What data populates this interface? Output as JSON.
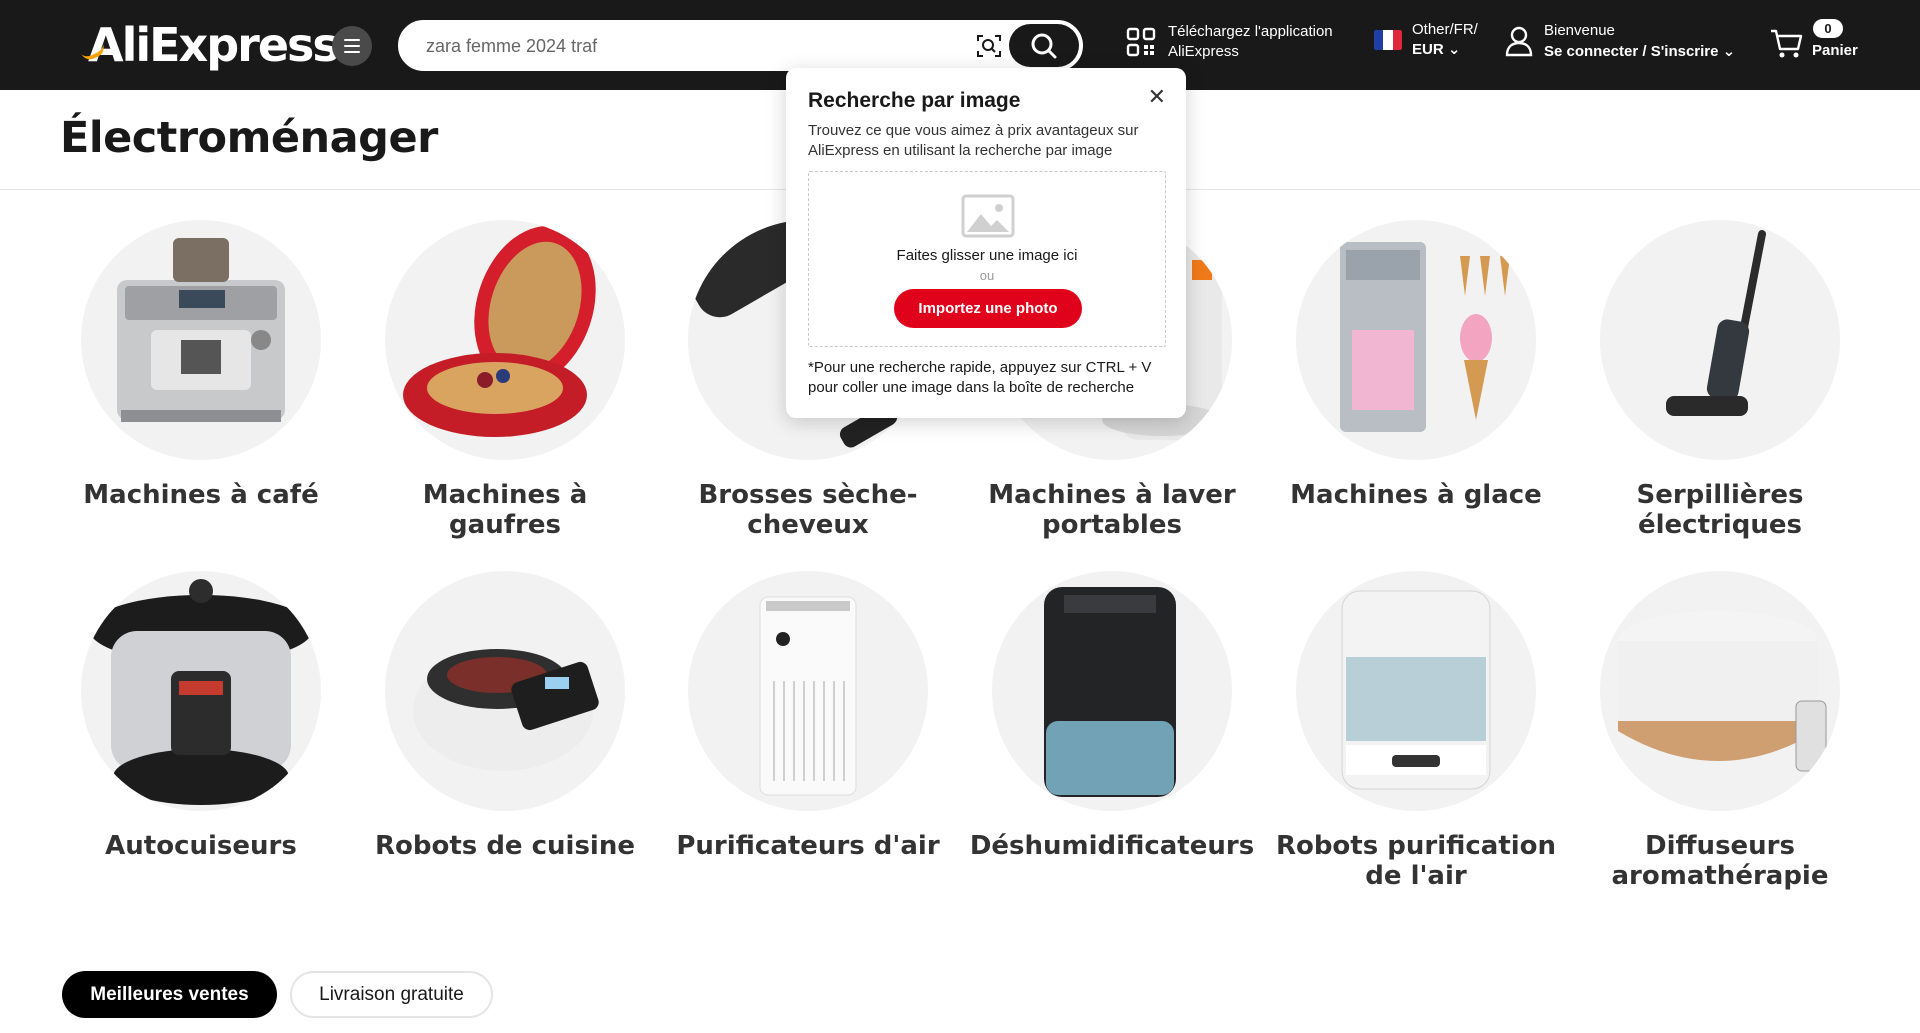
{
  "header": {
    "logo_text": "AliExpress",
    "search_value": "zara femme 2024 traf",
    "app_download_line1": "Téléchargez l'application",
    "app_download_line2": "AliExpress",
    "lang_line1": "Other/FR/",
    "lang_line2": "EUR",
    "account_line1": "Bienvenue",
    "account_line2": "Se connecter / S'inscrire",
    "cart_count": "0",
    "cart_label": "Panier"
  },
  "page": {
    "title": "Électroménager"
  },
  "categories": [
    {
      "name": "Machines à café",
      "icon": "coffee-machine"
    },
    {
      "name": "Machines à\ngaufres",
      "icon": "waffle-maker"
    },
    {
      "name": "Brosses sèche-\ncheveux",
      "icon": "hair-dryer-brush"
    },
    {
      "name": "Machines à laver\nportables",
      "icon": "portable-washer"
    },
    {
      "name": "Machines à glace",
      "icon": "ice-cream-machine"
    },
    {
      "name": "Serpillières\nélectriques",
      "icon": "electric-mop"
    },
    {
      "name": "Autocuiseurs",
      "icon": "pressure-cooker"
    },
    {
      "name": "Robots de cuisine",
      "icon": "kitchen-robot"
    },
    {
      "name": "Purificateurs d'air",
      "icon": "air-purifier"
    },
    {
      "name": "Déshumidificateurs",
      "icon": "dehumidifier"
    },
    {
      "name": "Robots purification\nde l'air",
      "icon": "air-purifier-robot"
    },
    {
      "name": "Diffuseurs\naromathérapie",
      "icon": "aroma-diffuser"
    }
  ],
  "tabs": {
    "best_sellers": "Meilleures ventes",
    "free_shipping": "Livraison gratuite"
  },
  "image_search_popup": {
    "title": "Recherche par image",
    "description": "Trouvez ce que vous aimez à prix avantageux sur AliExpress en utilisant la recherche par image",
    "drop_text": "Faites glisser une image ici",
    "or_text": "ou",
    "upload_label": "Importez une photo",
    "hint": "*Pour une recherche rapide, appuyez sur CTRL + V pour coller une image dans la boîte de recherche"
  },
  "colors": {
    "header_bg": "#191919",
    "accent_red": "#e0021a",
    "logo_orange": "#f7a100"
  }
}
